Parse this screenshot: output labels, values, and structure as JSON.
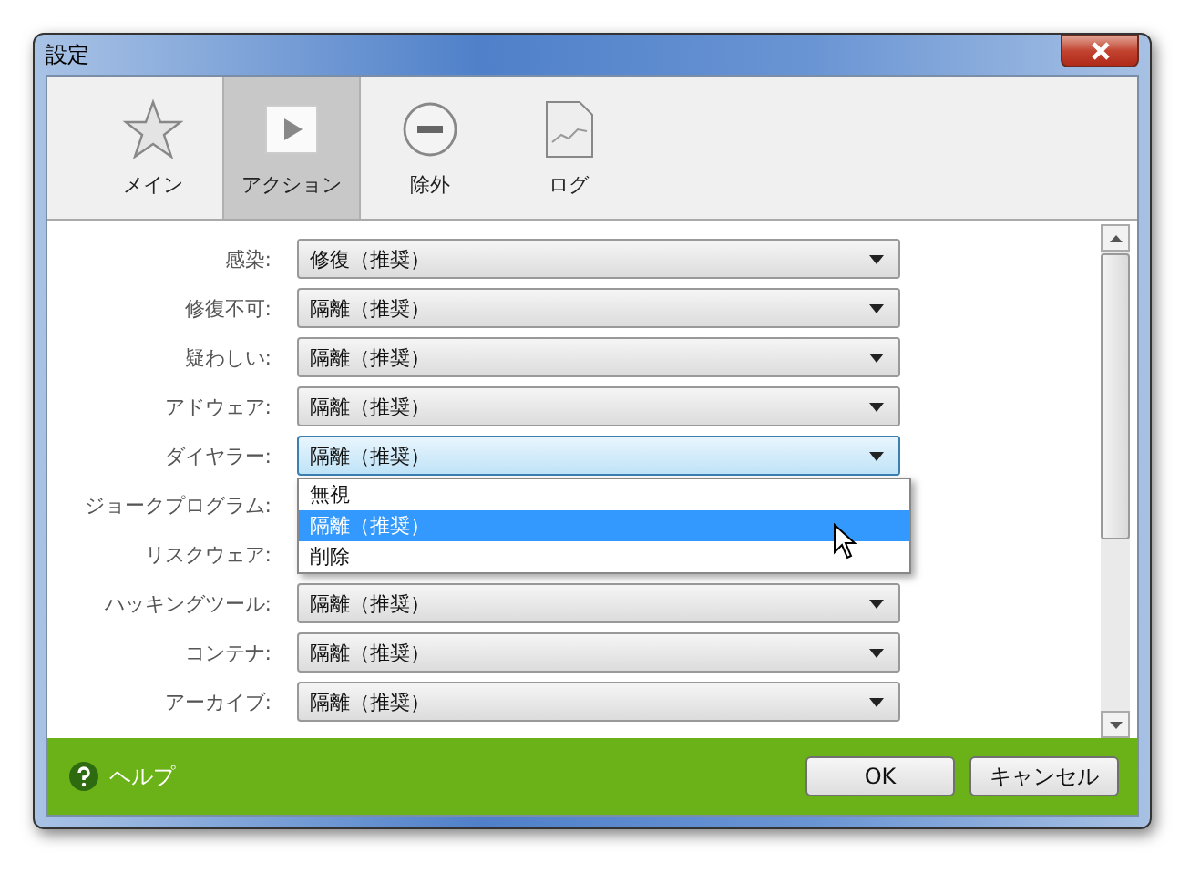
{
  "window": {
    "title": "設定"
  },
  "tabs": [
    {
      "label": "メイン",
      "selected": false,
      "kind": "star"
    },
    {
      "label": "アクション",
      "selected": true,
      "kind": "play"
    },
    {
      "label": "除外",
      "selected": false,
      "kind": "minus"
    },
    {
      "label": "ログ",
      "selected": false,
      "kind": "log"
    }
  ],
  "rows": [
    {
      "label": "感染:",
      "value": "修復（推奨）",
      "open": false
    },
    {
      "label": "修復不可:",
      "value": "隔離（推奨）",
      "open": false
    },
    {
      "label": "疑わしい:",
      "value": "隔離（推奨）",
      "open": false
    },
    {
      "label": "アドウェア:",
      "value": "隔離（推奨）",
      "open": false
    },
    {
      "label": "ダイヤラー:",
      "value": "隔離（推奨）",
      "open": true
    },
    {
      "label": "ジョークプログラム:",
      "open": false
    },
    {
      "label": "リスクウェア:",
      "open": false
    },
    {
      "label": "ハッキングツール:",
      "value": "隔離（推奨）",
      "open": false
    },
    {
      "label": "コンテナ:",
      "value": "隔離（推奨）",
      "open": false
    },
    {
      "label": "アーカイブ:",
      "value": "隔離（推奨）",
      "open": false
    }
  ],
  "dropdown_options": [
    {
      "label": "無視",
      "selected": false
    },
    {
      "label": "隔離（推奨）",
      "selected": true
    },
    {
      "label": "削除",
      "selected": false
    }
  ],
  "footer": {
    "help": "ヘルプ",
    "buttons": [
      "OK",
      "キャンセル"
    ]
  }
}
